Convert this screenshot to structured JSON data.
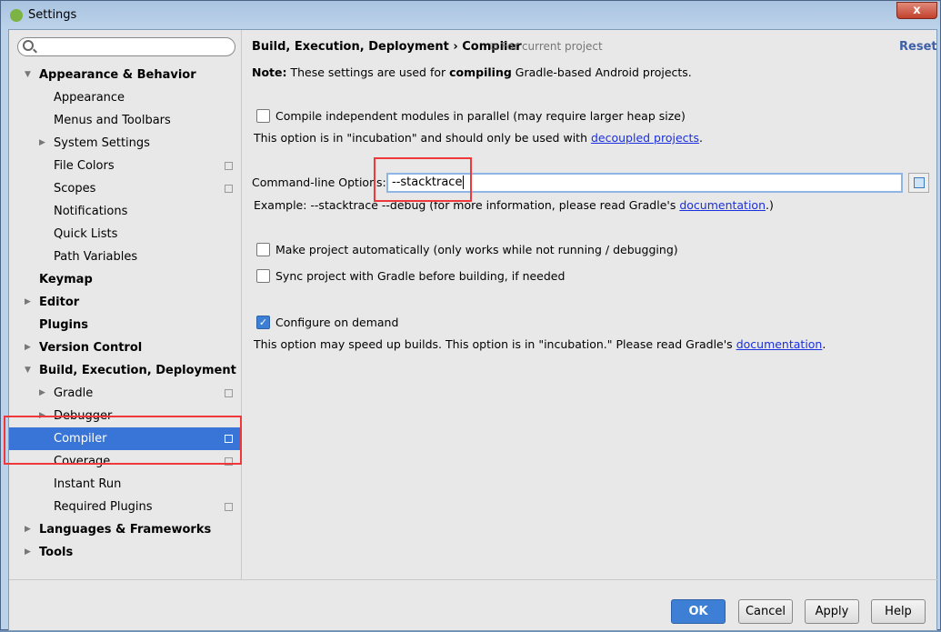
{
  "window": {
    "title": "Settings",
    "close_glyph": "x"
  },
  "search": {
    "placeholder": ""
  },
  "tree": [
    {
      "label": "Appearance & Behavior",
      "level": 0,
      "bold": true,
      "arrow": "▼"
    },
    {
      "label": "Appearance",
      "level": 1
    },
    {
      "label": "Menus and Toolbars",
      "level": 1
    },
    {
      "label": "System Settings",
      "level": 1,
      "arrow": "▶"
    },
    {
      "label": "File Colors",
      "level": 1,
      "copy": true
    },
    {
      "label": "Scopes",
      "level": 1,
      "copy": true
    },
    {
      "label": "Notifications",
      "level": 1
    },
    {
      "label": "Quick Lists",
      "level": 1
    },
    {
      "label": "Path Variables",
      "level": 1
    },
    {
      "label": "Keymap",
      "level": 0,
      "bold": true
    },
    {
      "label": "Editor",
      "level": 0,
      "bold": true,
      "arrow": "▶"
    },
    {
      "label": "Plugins",
      "level": 0,
      "bold": true
    },
    {
      "label": "Version Control",
      "level": 0,
      "bold": true,
      "arrow": "▶"
    },
    {
      "label": "Build, Execution, Deployment",
      "level": 0,
      "bold": true,
      "arrow": "▼"
    },
    {
      "label": "Gradle",
      "level": 1,
      "arrow": "▶",
      "copy": true
    },
    {
      "label": "Debugger",
      "level": 1,
      "arrow": "▶"
    },
    {
      "label": "Compiler",
      "level": 1,
      "copy": true,
      "selected": true
    },
    {
      "label": "Coverage",
      "level": 1,
      "copy": true
    },
    {
      "label": "Instant Run",
      "level": 1
    },
    {
      "label": "Required Plugins",
      "level": 1,
      "copy": true
    },
    {
      "label": "Languages & Frameworks",
      "level": 0,
      "bold": true,
      "arrow": "▶"
    },
    {
      "label": "Tools",
      "level": 0,
      "bold": true,
      "arrow": "▶"
    }
  ],
  "header": {
    "crumb1": "Build, Execution, Deployment",
    "sep": "›",
    "crumb2": "Compiler",
    "scope": "For current project",
    "reset": "Reset"
  },
  "note": {
    "label": "Note:",
    "pre": "These settings are used for",
    "bold": "compiling",
    "post": "Gradle-based Android projects."
  },
  "options": {
    "parallel": {
      "label": "Compile independent modules in parallel (may require larger heap size)",
      "checked": false
    },
    "parallel_hint": {
      "pre": "This option is in \"incubation\" and should only be used with",
      "link": "decoupled projects",
      "post": "."
    },
    "cmdline": {
      "label": "Command-line Options:",
      "value": "--stacktrace"
    },
    "cmdline_hint": {
      "pre": "Example: --stacktrace --debug (for more information, please read Gradle's",
      "link": "documentation",
      "post": ".)"
    },
    "make_auto": {
      "label": "Make project automatically (only works while not running / debugging)",
      "checked": false
    },
    "sync": {
      "label": "Sync project with Gradle before building, if needed",
      "checked": false
    },
    "on_demand": {
      "label": "Configure on demand",
      "checked": true
    },
    "on_demand_hint": {
      "pre": "This option may speed up builds. This option is in \"incubation.\" Please read Gradle's",
      "link": "documentation",
      "post": "."
    }
  },
  "footer": {
    "ok": "OK",
    "cancel": "Cancel",
    "apply": "Apply",
    "help": "Help"
  },
  "colors": {
    "selection": "#3875d7",
    "highlight": "#f0383a",
    "link": "#1a2fe0"
  }
}
